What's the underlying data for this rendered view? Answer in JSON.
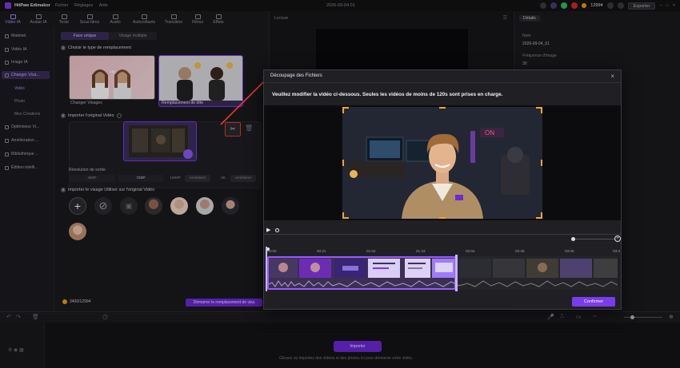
{
  "app": {
    "name": "HitPaw Edimakor",
    "menu": [
      "Fichier",
      "Réglages",
      "Aide"
    ],
    "date": "2026-09-04 01",
    "credits": "12994",
    "export_label": "Exporter"
  },
  "toolbar": {
    "items": [
      {
        "label": "Vidéo IA",
        "icon": "ai-video-icon"
      },
      {
        "label": "Avatar IA",
        "icon": "avatar-icon"
      },
      {
        "label": "Texte",
        "icon": "text-icon"
      },
      {
        "label": "Sous-titres",
        "icon": "subtitles-icon"
      },
      {
        "label": "Audio",
        "icon": "audio-icon"
      },
      {
        "label": "Autocollants",
        "icon": "sticker-icon"
      },
      {
        "label": "Transition",
        "icon": "transition-icon"
      },
      {
        "label": "Filtres",
        "icon": "filter-icon"
      },
      {
        "label": "Effets",
        "icon": "effects-icon"
      }
    ]
  },
  "sidebar": {
    "items": [
      "Matériel",
      "Vidéo IA",
      "Image IA",
      "Changer Visa..."
    ],
    "sub": [
      "Vidéo",
      "Photo",
      "Mes Créations"
    ],
    "more": [
      "Optimiseur Vi...",
      "Amélioration ...",
      "Bibliothèque ...",
      "Édition intelli..."
    ]
  },
  "panel": {
    "seg_single": "Face unique",
    "seg_multi": "Visage multiple",
    "step1": "Choisir le type de remplacement",
    "card1_label": "Changer Visages",
    "card2_label": "Remplacement de tête",
    "step2": "Importer l'original Vidéo",
    "resolution_label": "Résolution de sortie",
    "resolutions": [
      "480P",
      "720P",
      "1080P",
      "Améliorer",
      "2K",
      "Améliorer"
    ],
    "step3": "Importer le visage Utiliser sur l'original Vidéo",
    "credits_text": "3400/12994",
    "start_button": "Démarrer le remplacement de visa"
  },
  "preview": {
    "title": "Lecture"
  },
  "details": {
    "tab": "Détails",
    "name_label": "Nom",
    "name_value": "2026-09-04_01",
    "rate_label": "Fréquence d'image",
    "rate_value": "30"
  },
  "timeline": {
    "import_label": "Importer",
    "hint": "Glissez ou importez des vidéos et des photos ici pour démarrer votre vidéo."
  },
  "modal": {
    "title": "Découpage des Fichiers",
    "message": "Veuillez modifier la vidéo ci-dessous. Seules les vidéos de moins de 120s sont prises en charge.",
    "confirm": "Confirmer",
    "ruler": [
      "00:00",
      "00:31",
      "01:02",
      "01:33",
      "02:04",
      "02:35",
      "03:06",
      "03:3"
    ]
  },
  "colors": {
    "accent": "#7c3aed",
    "crop_handle": "#f5a623",
    "highlight_red": "#e53935"
  }
}
